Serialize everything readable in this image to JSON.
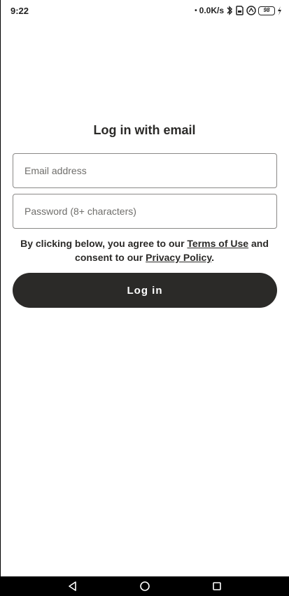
{
  "status_bar": {
    "time": "9:22",
    "net_speed": "0.0K/s",
    "battery": "98"
  },
  "login": {
    "title": "Log in with email",
    "email_placeholder": "Email address",
    "password_placeholder": "Password (8+ characters)",
    "consent_prefix": "By clicking below, you agree to our ",
    "terms_link": "Terms of Use",
    "consent_middle": " and consent to our ",
    "privacy_link": "Privacy Policy",
    "consent_suffix": ".",
    "login_button": "Log in"
  },
  "colors": {
    "primary": "#2b2a28",
    "background": "#ffffff",
    "field_border": "#8a8987"
  },
  "icons": {
    "status": [
      "bluetooth-icon",
      "sim-icon",
      "nfc-icon",
      "battery-icon",
      "charging-icon"
    ],
    "nav": [
      "back-icon",
      "home-icon",
      "recents-icon"
    ]
  }
}
